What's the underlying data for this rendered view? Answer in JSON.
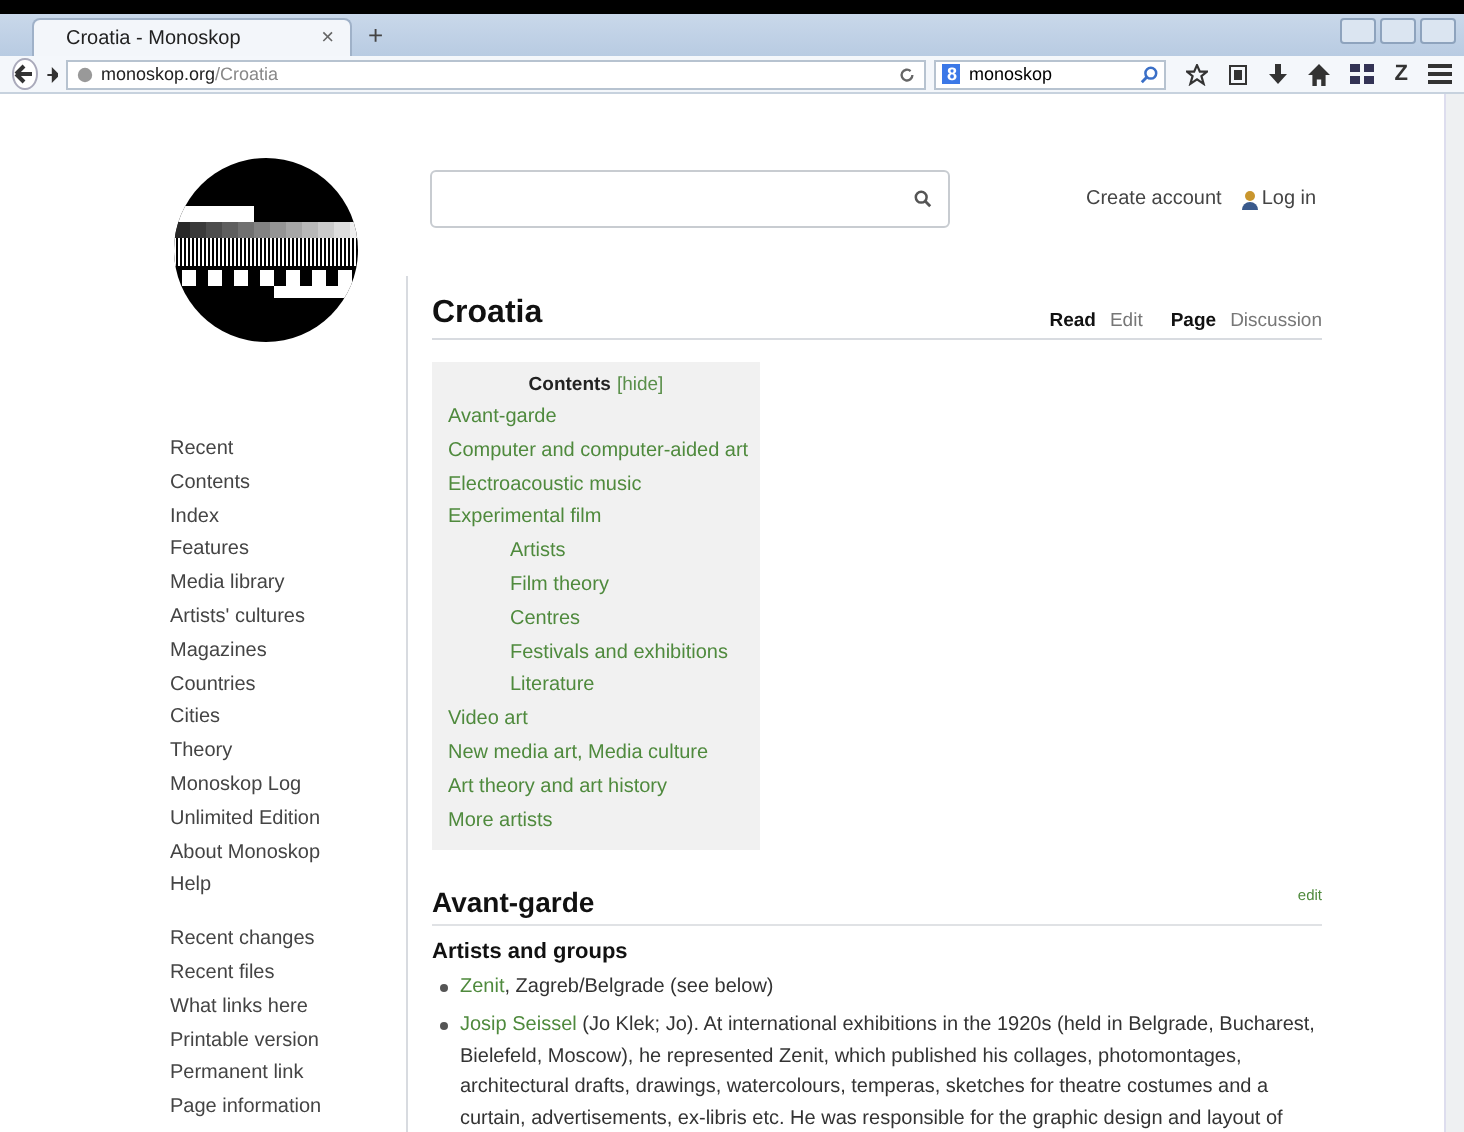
{
  "browser": {
    "tab_title": "Croatia - Monoskop",
    "tab_close": "×",
    "new_tab": "+",
    "url_host": "monoskop.org",
    "url_path": "/Croatia",
    "search_engine": "8",
    "search_text": "monoskop",
    "toolbar_z": "Z"
  },
  "header": {
    "create_account": "Create account",
    "log_in": "Log in"
  },
  "sidebar": {
    "groups": [
      [
        "Recent",
        "Contents",
        "Index",
        "Features",
        "Media library",
        "Artists' cultures",
        "Magazines",
        "Countries",
        "Cities",
        "Theory",
        "Monoskop Log",
        "Unlimited Edition",
        "About Monoskop",
        "Help"
      ],
      [
        "Recent changes",
        "Recent files",
        "What links here",
        "Printable version",
        "Permanent link",
        "Page information"
      ]
    ]
  },
  "page": {
    "title": "Croatia",
    "views": [
      {
        "label": "Read",
        "selected": true
      },
      {
        "label": "Edit",
        "selected": false
      }
    ],
    "namespaces": [
      {
        "label": "Page",
        "selected": true
      },
      {
        "label": "Discussion",
        "selected": false
      }
    ],
    "toc": {
      "title": "Contents",
      "toggle": "[hide]",
      "items": [
        {
          "label": "Avant-garde"
        },
        {
          "label": "Computer and computer-aided art"
        },
        {
          "label": "Electroacoustic music"
        },
        {
          "label": "Experimental film",
          "children": [
            {
              "label": "Artists"
            },
            {
              "label": "Film theory"
            },
            {
              "label": "Centres"
            },
            {
              "label": "Festivals and exhibitions"
            },
            {
              "label": "Literature"
            }
          ]
        },
        {
          "label": "Video art"
        },
        {
          "label": "New media art, Media culture"
        },
        {
          "label": "Art theory and art history"
        },
        {
          "label": "More artists"
        }
      ]
    },
    "section": {
      "heading": "Avant-garde",
      "edit": "edit",
      "subheading": "Artists and groups",
      "bullets": [
        {
          "link": "Zenit",
          "text": ", Zagreb/Belgrade (see below)"
        },
        {
          "link": "Josip Seissel",
          "text": " (Jo Klek; Jo). At international exhibitions in the 1920s (held in Belgrade, Bucharest, Bielefeld, Moscow), he represented Zenit, which published his collages, photomontages, architectural drafts, drawings, watercolours, temperas, sketches for theatre costumes and a curtain, advertisements, ex-libris etc. He was responsible for the graphic design and layout of"
        }
      ]
    }
  }
}
